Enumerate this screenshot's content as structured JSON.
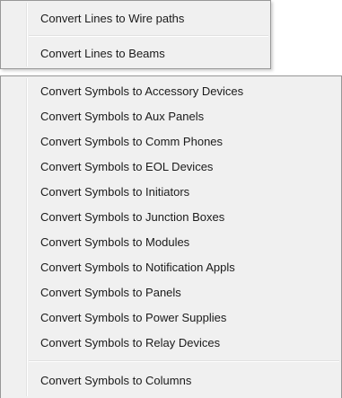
{
  "top_menu": {
    "items": [
      {
        "label": "Convert Lines to Wire paths"
      },
      {
        "label": "Convert Lines to Beams"
      }
    ]
  },
  "bottom_menu": {
    "items": [
      {
        "label": "Convert Symbols to Accessory Devices"
      },
      {
        "label": "Convert Symbols to Aux Panels"
      },
      {
        "label": "Convert Symbols to Comm Phones"
      },
      {
        "label": "Convert Symbols to EOL Devices"
      },
      {
        "label": "Convert Symbols to Initiators"
      },
      {
        "label": "Convert Symbols to Junction Boxes"
      },
      {
        "label": "Convert Symbols to Modules"
      },
      {
        "label": "Convert Symbols to Notification Appls"
      },
      {
        "label": "Convert Symbols to Panels"
      },
      {
        "label": "Convert Symbols to Power Supplies"
      },
      {
        "label": "Convert Symbols to Relay Devices"
      },
      {
        "label": "Convert Symbols to Columns"
      }
    ]
  }
}
